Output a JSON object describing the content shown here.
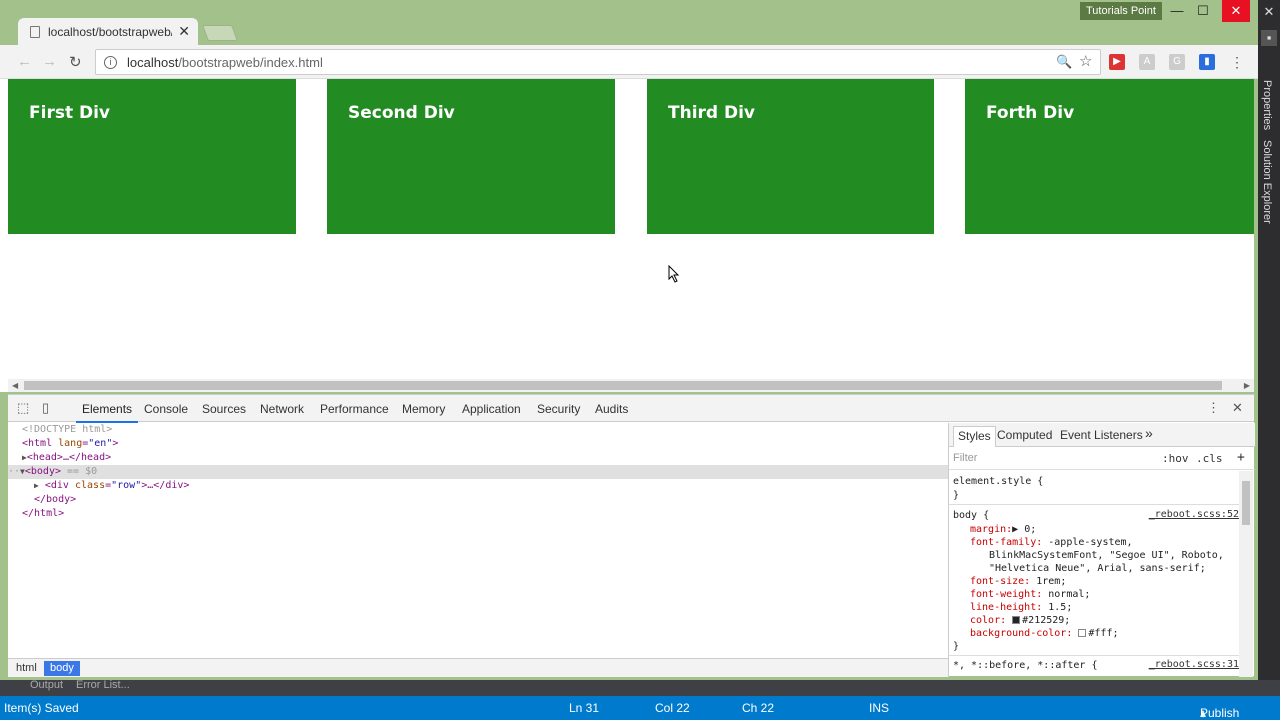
{
  "browser": {
    "tab_title": "localhost/bootstrapweb/",
    "tab_close": "✕",
    "profile_name": "Tutorials Point",
    "url_host": "localhost",
    "url_path": "/bootstrapweb/index.html",
    "window_controls": [
      "—",
      "☐",
      "✕"
    ],
    "nav": [
      "←",
      "→",
      "↻"
    ],
    "omnibox_icons": [
      "🔍",
      "☆"
    ]
  },
  "page": {
    "divs": [
      {
        "label": "First Div"
      },
      {
        "label": "Second Div"
      },
      {
        "label": "Third Div"
      },
      {
        "label": "Forth Div"
      }
    ],
    "div_color": "#228b22"
  },
  "devtools": {
    "tabs": [
      "Elements",
      "Console",
      "Sources",
      "Network",
      "Performance",
      "Memory",
      "Application",
      "Security",
      "Audits"
    ],
    "active_tab": "Elements",
    "dom": {
      "doctype": "<!DOCTYPE html>",
      "html_open_tag": "<html",
      "html_lang_attr": "lang",
      "html_lang_val": "\"en\"",
      "gt": ">",
      "head": "<head>…</head>",
      "body_open": "<body>",
      "body_eq": " == $0",
      "div_open": "<div",
      "div_class_attr": "class",
      "div_class_val": "\"row\"",
      "div_rest": ">…</div>",
      "body_close": "</body>",
      "html_close": "</html>"
    },
    "breadcrumbs": [
      "html",
      "body"
    ],
    "styles": {
      "tabs": [
        "Styles",
        "Computed",
        "Event Listeners",
        "»"
      ],
      "filter_placeholder": "Filter",
      "hov": ":hov",
      "cls": ".cls",
      "plus": "+",
      "element_style_open": "element.style {",
      "close_brace": "}",
      "body_selector": "body {",
      "body_source": "_reboot.scss:52",
      "props": {
        "margin": "margin:",
        "margin_val": "▶ 0;",
        "font_family": "font-family:",
        "font_family_val1": " -apple-system,",
        "font_family_val2": "BlinkMacSystemFont, \"Segoe UI\", Roboto,",
        "font_family_val3": "\"Helvetica Neue\", Arial, sans-serif;",
        "font_size": "font-size:",
        "font_size_val": " 1rem;",
        "font_weight": "font-weight:",
        "font_weight_val": " normal;",
        "line_height": "line-height:",
        "line_height_val": " 1.5;",
        "color": "color:",
        "color_val": "#212529;",
        "bg": "background-color:",
        "bg_val": "#fff;"
      },
      "universal_selector": "*, *::before, *::after {",
      "universal_source": "_reboot.scss:31"
    }
  },
  "vs": {
    "side_tabs": [
      "Properties",
      "Solution Explorer"
    ],
    "dock_items": [
      "Output",
      "Error List..."
    ],
    "status": {
      "message": "Item(s) Saved",
      "ln": "Ln 31",
      "col": "Col 22",
      "ch": "Ch 22",
      "ins": "INS",
      "publish": "Publish"
    }
  }
}
